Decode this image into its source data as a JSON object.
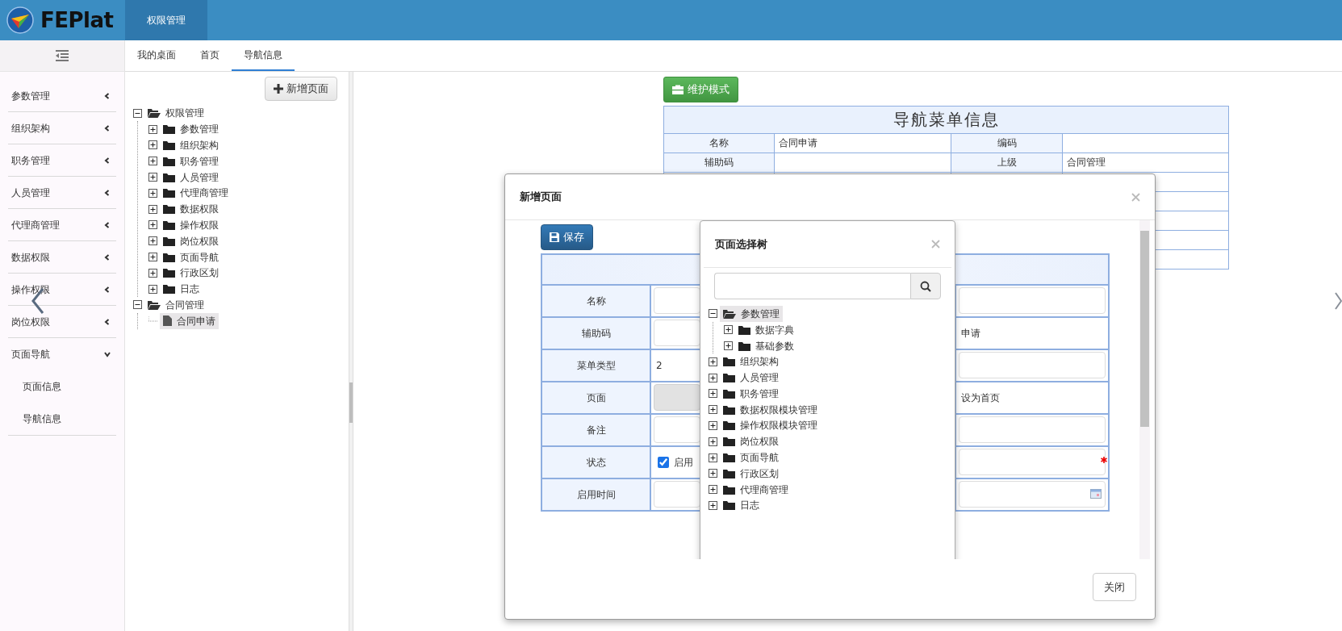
{
  "app": {
    "logo_text": "FEPlat"
  },
  "top_tabs": [
    {
      "label": "权限管理",
      "selected": true
    }
  ],
  "sidebar": {
    "items": [
      {
        "label": "参数管理",
        "expanded": false
      },
      {
        "label": "组织架构",
        "expanded": false
      },
      {
        "label": "职务管理",
        "expanded": false
      },
      {
        "label": "人员管理",
        "expanded": false
      },
      {
        "label": "代理商管理",
        "expanded": false
      },
      {
        "label": "数据权限",
        "expanded": false
      },
      {
        "label": "操作权限",
        "expanded": false
      },
      {
        "label": "岗位权限",
        "expanded": false
      },
      {
        "label": "页面导航",
        "expanded": true,
        "children": [
          {
            "label": "页面信息"
          },
          {
            "label": "导航信息"
          }
        ]
      }
    ]
  },
  "tabs": [
    {
      "label": "我的桌面",
      "selected": false
    },
    {
      "label": "首页",
      "selected": false
    },
    {
      "label": "导航信息",
      "selected": true
    }
  ],
  "nav_tree": {
    "add_button": "新增页面",
    "nodes": [
      {
        "label": "权限管理",
        "kind": "folder",
        "expanded": true,
        "selected": false,
        "children": [
          {
            "label": "参数管理",
            "kind": "folder",
            "expanded": false,
            "selected": false
          },
          {
            "label": "组织架构",
            "kind": "folder",
            "expanded": false,
            "selected": false
          },
          {
            "label": "职务管理",
            "kind": "folder",
            "expanded": false,
            "selected": false
          },
          {
            "label": "人员管理",
            "kind": "folder",
            "expanded": false,
            "selected": false
          },
          {
            "label": "代理商管理",
            "kind": "folder",
            "expanded": false,
            "selected": false
          },
          {
            "label": "数据权限",
            "kind": "folder",
            "expanded": false,
            "selected": false
          },
          {
            "label": "操作权限",
            "kind": "folder",
            "expanded": false,
            "selected": false
          },
          {
            "label": "岗位权限",
            "kind": "folder",
            "expanded": false,
            "selected": false
          },
          {
            "label": "页面导航",
            "kind": "folder",
            "expanded": false,
            "selected": false
          },
          {
            "label": "行政区划",
            "kind": "folder",
            "expanded": false,
            "selected": false
          },
          {
            "label": "日志",
            "kind": "folder",
            "expanded": false,
            "selected": false
          }
        ]
      },
      {
        "label": "合同管理",
        "kind": "folder",
        "expanded": true,
        "selected": false,
        "children": [
          {
            "label": "合同申请",
            "kind": "file",
            "selected": true
          }
        ]
      }
    ]
  },
  "detail": {
    "mode_button": "维护模式",
    "title": "导航菜单信息",
    "fields": [
      {
        "label": "名称",
        "value": "合同申请"
      },
      {
        "label": "编码"
      },
      {
        "label": "辅助码"
      },
      {
        "label": "上级",
        "value": "合同管理"
      }
    ]
  },
  "dialog": {
    "title": "新增页面",
    "save_button": "保存",
    "close_button": "关闭",
    "rows": [
      {
        "label": "名称",
        "left": {
          "kind": "input",
          "disabled": false
        },
        "right": {
          "kind": "input",
          "disabled": false,
          "required": false
        }
      },
      {
        "label": "辅助码",
        "left": {
          "kind": "input",
          "disabled": false
        },
        "right": {
          "kind": "text",
          "text": "申请"
        }
      },
      {
        "label": "菜单类型",
        "left": {
          "kind": "text",
          "text": "2"
        },
        "right": {
          "kind": "input",
          "disabled": false,
          "required": false
        }
      },
      {
        "label": "页面",
        "left": {
          "kind": "input",
          "disabled": true
        },
        "right": {
          "kind": "text",
          "text": "设为首页"
        }
      },
      {
        "label": "备注",
        "left": {
          "kind": "input",
          "disabled": false
        },
        "right": {
          "kind": "input",
          "disabled": false,
          "required": false
        }
      },
      {
        "label": "状态",
        "left": {
          "kind": "checkbox",
          "checked": true,
          "text": "启用"
        },
        "right": {
          "kind": "input",
          "disabled": false,
          "required": true
        }
      },
      {
        "label": "启用时间",
        "left": {
          "kind": "input",
          "disabled": false
        },
        "right": {
          "kind": "date"
        }
      }
    ]
  },
  "picker": {
    "title": "页面选择树",
    "nodes": [
      {
        "label": "参数管理",
        "kind": "folder",
        "expanded": true,
        "selected": true,
        "children": [
          {
            "label": "数据字典",
            "kind": "folder",
            "expanded": false,
            "selected": false
          },
          {
            "label": "基础参数",
            "kind": "folder",
            "expanded": false,
            "selected": false
          }
        ]
      },
      {
        "label": "组织架构",
        "kind": "folder",
        "expanded": false,
        "selected": false
      },
      {
        "label": "人员管理",
        "kind": "folder",
        "expanded": false,
        "selected": false
      },
      {
        "label": "职务管理",
        "kind": "folder",
        "expanded": false,
        "selected": false
      },
      {
        "label": "数据权限模块管理",
        "kind": "folder",
        "expanded": false,
        "selected": false
      },
      {
        "label": "操作权限模块管理",
        "kind": "folder",
        "expanded": false,
        "selected": false
      },
      {
        "label": "岗位权限",
        "kind": "folder",
        "expanded": false,
        "selected": false
      },
      {
        "label": "页面导航",
        "kind": "folder",
        "expanded": false,
        "selected": false
      },
      {
        "label": "行政区划",
        "kind": "folder",
        "expanded": false,
        "selected": false
      },
      {
        "label": "代理商管理",
        "kind": "folder",
        "expanded": false,
        "selected": false
      },
      {
        "label": "日志",
        "kind": "folder",
        "expanded": false,
        "selected": false
      }
    ]
  }
}
